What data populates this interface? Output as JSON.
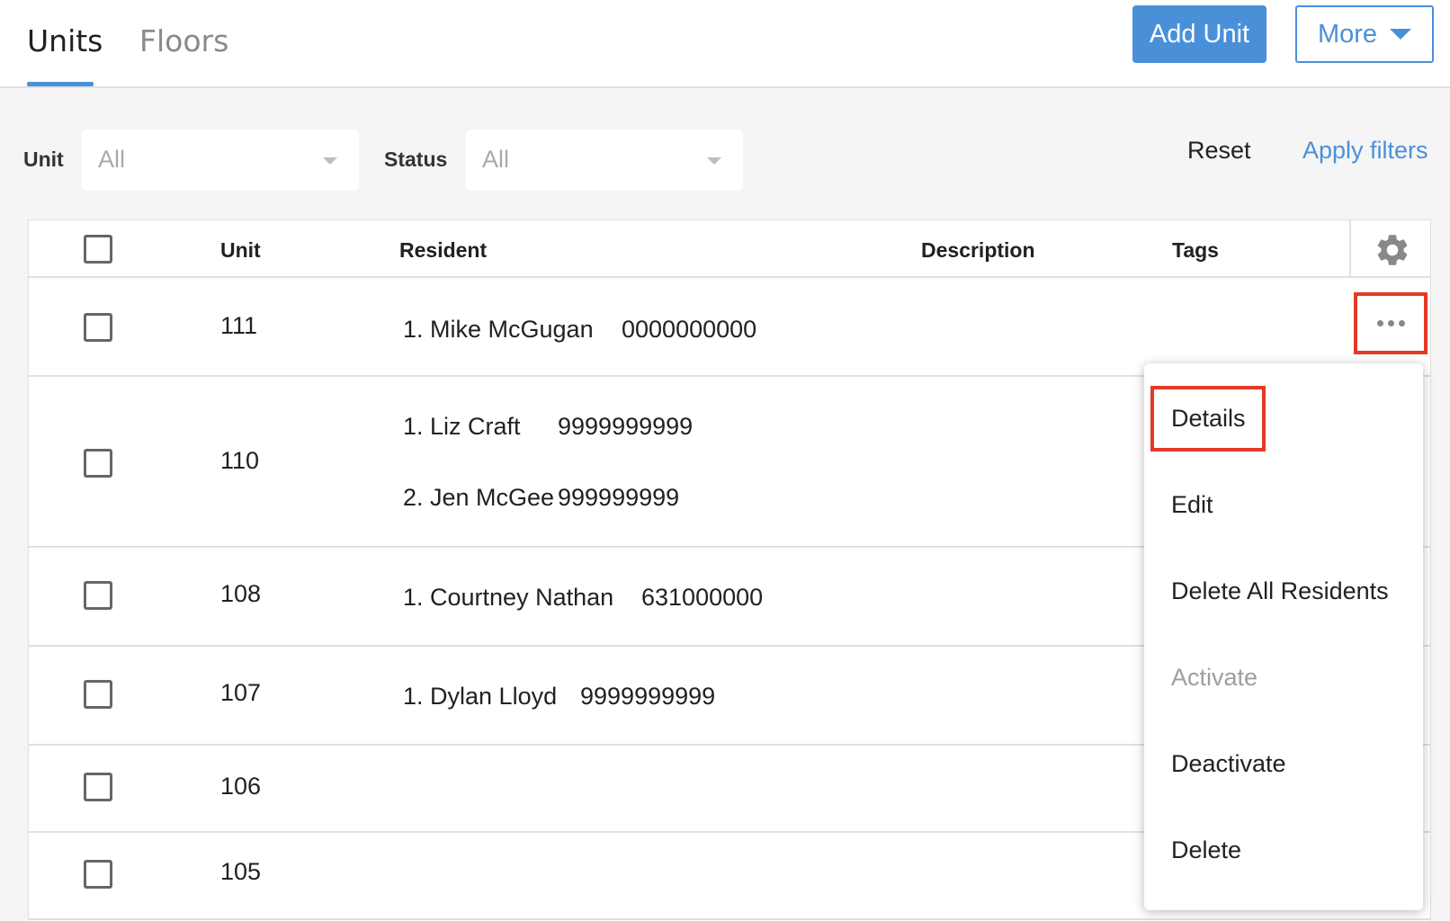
{
  "tabs": [
    {
      "label": "Units",
      "active": true
    },
    {
      "label": "Floors",
      "active": false
    }
  ],
  "header": {
    "add_unit_label": "Add Unit",
    "more_label": "More"
  },
  "filters": {
    "unit_label": "Unit",
    "unit_value": "All",
    "status_label": "Status",
    "status_value": "All",
    "reset_label": "Reset",
    "apply_label": "Apply filters"
  },
  "table": {
    "columns": [
      "Unit",
      "Resident",
      "Description",
      "Tags"
    ],
    "rows": [
      {
        "unit": "111",
        "residents": [
          {
            "name": "1. Mike McGugan",
            "phone": "0000000000"
          }
        ]
      },
      {
        "unit": "110",
        "residents": [
          {
            "name": "1. Liz Craft",
            "phone": "9999999999"
          },
          {
            "name": "2. Jen McGee",
            "phone": "999999999"
          }
        ]
      },
      {
        "unit": "108",
        "residents": [
          {
            "name": "1. Courtney Nathan",
            "phone": "631000000"
          }
        ]
      },
      {
        "unit": "107",
        "residents": [
          {
            "name": "1. Dylan Lloyd",
            "phone": "9999999999"
          }
        ]
      },
      {
        "unit": "106",
        "residents": []
      },
      {
        "unit": "105",
        "residents": []
      }
    ]
  },
  "row_menu": {
    "items": [
      {
        "label": "Details",
        "enabled": true
      },
      {
        "label": "Edit",
        "enabled": true
      },
      {
        "label": "Delete All Residents",
        "enabled": true
      },
      {
        "label": "Activate",
        "enabled": false
      },
      {
        "label": "Deactivate",
        "enabled": true
      },
      {
        "label": "Delete",
        "enabled": true
      }
    ]
  },
  "colors": {
    "accent": "#4a90d9",
    "highlight": "#e33a26",
    "disabled_text": "#9e9e9e"
  },
  "icons": [
    "gear-icon",
    "more-dots-icon",
    "chevron-down-icon"
  ]
}
